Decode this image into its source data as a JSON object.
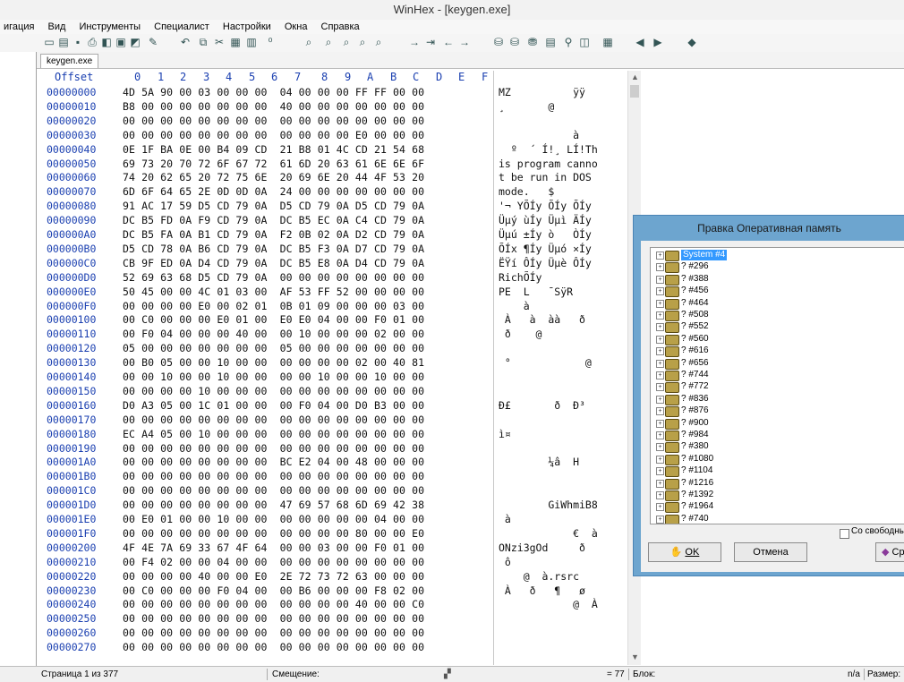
{
  "window": {
    "title": "WinHex - [keygen.exe]"
  },
  "menu": [
    "игация",
    "Вид",
    "Инструменты",
    "Специалист",
    "Настройки",
    "Окна",
    "Справка"
  ],
  "tabs": [
    "keygen.exe"
  ],
  "hex_header": {
    "offset_label": "Offset",
    "columns": [
      "0",
      "1",
      "2",
      "3",
      "4",
      "5",
      "6",
      "7",
      "8",
      "9",
      "A",
      "B",
      "C",
      "D",
      "E",
      "F"
    ]
  },
  "rows": [
    {
      "offset": "00000000",
      "bytes": "4D 5A 90 00 03 00 00 00  04 00 00 00 FF FF 00 00",
      "ascii": "MZ          ÿÿ"
    },
    {
      "offset": "00000010",
      "bytes": "B8 00 00 00 00 00 00 00  40 00 00 00 00 00 00 00",
      "ascii": "¸       @"
    },
    {
      "offset": "00000020",
      "bytes": "00 00 00 00 00 00 00 00  00 00 00 00 00 00 00 00",
      "ascii": ""
    },
    {
      "offset": "00000030",
      "bytes": "00 00 00 00 00 00 00 00  00 00 00 00 E0 00 00 00",
      "ascii": "            à"
    },
    {
      "offset": "00000040",
      "bytes": "0E 1F BA 0E 00 B4 09 CD  21 B8 01 4C CD 21 54 68",
      "ascii": "  º  ´ Í!¸ LÍ!Th"
    },
    {
      "offset": "00000050",
      "bytes": "69 73 20 70 72 6F 67 72  61 6D 20 63 61 6E 6E 6F",
      "ascii": "is program canno"
    },
    {
      "offset": "00000060",
      "bytes": "74 20 62 65 20 72 75 6E  20 69 6E 20 44 4F 53 20",
      "ascii": "t be run in DOS "
    },
    {
      "offset": "00000070",
      "bytes": "6D 6F 64 65 2E 0D 0D 0A  24 00 00 00 00 00 00 00",
      "ascii": "mode.   $"
    },
    {
      "offset": "00000080",
      "bytes": "91 AC 17 59 D5 CD 79 0A  D5 CD 79 0A D5 CD 79 0A",
      "ascii": "'¬ YÕÍy ÕÍy ÕÍy"
    },
    {
      "offset": "00000090",
      "bytes": "DC B5 FD 0A F9 CD 79 0A  DC B5 EC 0A C4 CD 79 0A",
      "ascii": "Üµý ùÍy Üµì ÄÍy"
    },
    {
      "offset": "000000A0",
      "bytes": "DC B5 FA 0A B1 CD 79 0A  F2 0B 02 0A D2 CD 79 0A",
      "ascii": "Üµú ±Íy ò   ÒÍy"
    },
    {
      "offset": "000000B0",
      "bytes": "D5 CD 78 0A B6 CD 79 0A  DC B5 F3 0A D7 CD 79 0A",
      "ascii": "ÕÍx ¶Íy Üµó ×Íy"
    },
    {
      "offset": "000000C0",
      "bytes": "CB 9F ED 0A D4 CD 79 0A  DC B5 E8 0A D4 CD 79 0A",
      "ascii": "ËŸí ÔÍy Üµè ÔÍy"
    },
    {
      "offset": "000000D0",
      "bytes": "52 69 63 68 D5 CD 79 0A  00 00 00 00 00 00 00 00",
      "ascii": "RichÕÍy"
    },
    {
      "offset": "000000E0",
      "bytes": "50 45 00 00 4C 01 03 00  AF 53 FF 52 00 00 00 00",
      "ascii": "PE  L   ¯SÿR"
    },
    {
      "offset": "000000F0",
      "bytes": "00 00 00 00 E0 00 02 01  0B 01 09 00 00 00 03 00",
      "ascii": "    à"
    },
    {
      "offset": "00000100",
      "bytes": "00 C0 00 00 00 E0 01 00  E0 E0 04 00 00 F0 01 00",
      "ascii": " À   à  àà   ð"
    },
    {
      "offset": "00000110",
      "bytes": "00 F0 04 00 00 00 40 00  00 10 00 00 00 02 00 00",
      "ascii": " ð    @"
    },
    {
      "offset": "00000120",
      "bytes": "05 00 00 00 00 00 00 00  05 00 00 00 00 00 00 00",
      "ascii": ""
    },
    {
      "offset": "00000130",
      "bytes": "00 B0 05 00 00 10 00 00  00 00 00 00 02 00 40 81",
      "ascii": " °            @"
    },
    {
      "offset": "00000140",
      "bytes": "00 00 10 00 00 10 00 00  00 00 10 00 00 10 00 00",
      "ascii": ""
    },
    {
      "offset": "00000150",
      "bytes": "00 00 00 00 10 00 00 00  00 00 00 00 00 00 00 00",
      "ascii": ""
    },
    {
      "offset": "00000160",
      "bytes": "D0 A3 05 00 1C 01 00 00  00 F0 04 00 D0 B3 00 00",
      "ascii": "Ð£       ð  Ð³"
    },
    {
      "offset": "00000170",
      "bytes": "00 00 00 00 00 00 00 00  00 00 00 00 00 00 00 00",
      "ascii": ""
    },
    {
      "offset": "00000180",
      "bytes": "EC A4 05 00 10 00 00 00  00 00 00 00 00 00 00 00",
      "ascii": "ì¤"
    },
    {
      "offset": "00000190",
      "bytes": "00 00 00 00 00 00 00 00  00 00 00 00 00 00 00 00",
      "ascii": ""
    },
    {
      "offset": "000001A0",
      "bytes": "00 00 00 00 00 00 00 00  BC E2 04 00 48 00 00 00",
      "ascii": "        ¼â  H"
    },
    {
      "offset": "000001B0",
      "bytes": "00 00 00 00 00 00 00 00  00 00 00 00 00 00 00 00",
      "ascii": ""
    },
    {
      "offset": "000001C0",
      "bytes": "00 00 00 00 00 00 00 00  00 00 00 00 00 00 00 00",
      "ascii": ""
    },
    {
      "offset": "000001D0",
      "bytes": "00 00 00 00 00 00 00 00  47 69 57 68 6D 69 42 38",
      "ascii": "        GiWhmiB8"
    },
    {
      "offset": "000001E0",
      "bytes": "00 E0 01 00 00 10 00 00  00 00 00 00 00 04 00 00",
      "ascii": " à"
    },
    {
      "offset": "000001F0",
      "bytes": "00 00 00 00 00 00 00 00  00 00 00 00 80 00 00 E0",
      "ascii": "            €  à"
    },
    {
      "offset": "00000200",
      "bytes": "4F 4E 7A 69 33 67 4F 64  00 00 03 00 00 F0 01 00",
      "ascii": "ONzi3gOd     ð"
    },
    {
      "offset": "00000210",
      "bytes": "00 F4 02 00 00 04 00 00  00 00 00 00 00 00 00 00",
      "ascii": " ô"
    },
    {
      "offset": "00000220",
      "bytes": "00 00 00 00 40 00 00 E0  2E 72 73 72 63 00 00 00",
      "ascii": "    @  à.rsrc"
    },
    {
      "offset": "00000230",
      "bytes": "00 C0 00 00 00 F0 04 00  00 B6 00 00 00 F8 02 00",
      "ascii": " À   ð   ¶   ø"
    },
    {
      "offset": "00000240",
      "bytes": "00 00 00 00 00 00 00 00  00 00 00 00 40 00 00 C0",
      "ascii": "            @  À"
    },
    {
      "offset": "00000250",
      "bytes": "00 00 00 00 00 00 00 00  00 00 00 00 00 00 00 00",
      "ascii": ""
    },
    {
      "offset": "00000260",
      "bytes": "00 00 00 00 00 00 00 00  00 00 00 00 00 00 00 00",
      "ascii": ""
    },
    {
      "offset": "00000270",
      "bytes": "00 00 00 00 00 00 00 00  00 00 00 00 00 00 00 00",
      "ascii": ""
    }
  ],
  "dialog": {
    "title": "Правка Оперативная память",
    "items": [
      "System #4",
      "? #296",
      "? #388",
      "? #456",
      "? #464",
      "? #508",
      "? #552",
      "? #560",
      "? #616",
      "? #656",
      "? #744",
      "? #772",
      "? #836",
      "? #876",
      "? #900",
      "? #984",
      "? #380",
      "? #1080",
      "? #1104",
      "? #1216",
      "? #1392",
      "? #1964",
      "? #740"
    ],
    "checkbox_label": "Со свободным п",
    "ok_label": "OK",
    "cancel_label": "Отмена",
    "third_label": "Ср"
  },
  "status": {
    "page": "Страница 1 из 377",
    "offset_label": "Смещение:",
    "value": "= 77",
    "block_label": "Блок:",
    "na": "n/a",
    "size_label": "Размер:"
  }
}
